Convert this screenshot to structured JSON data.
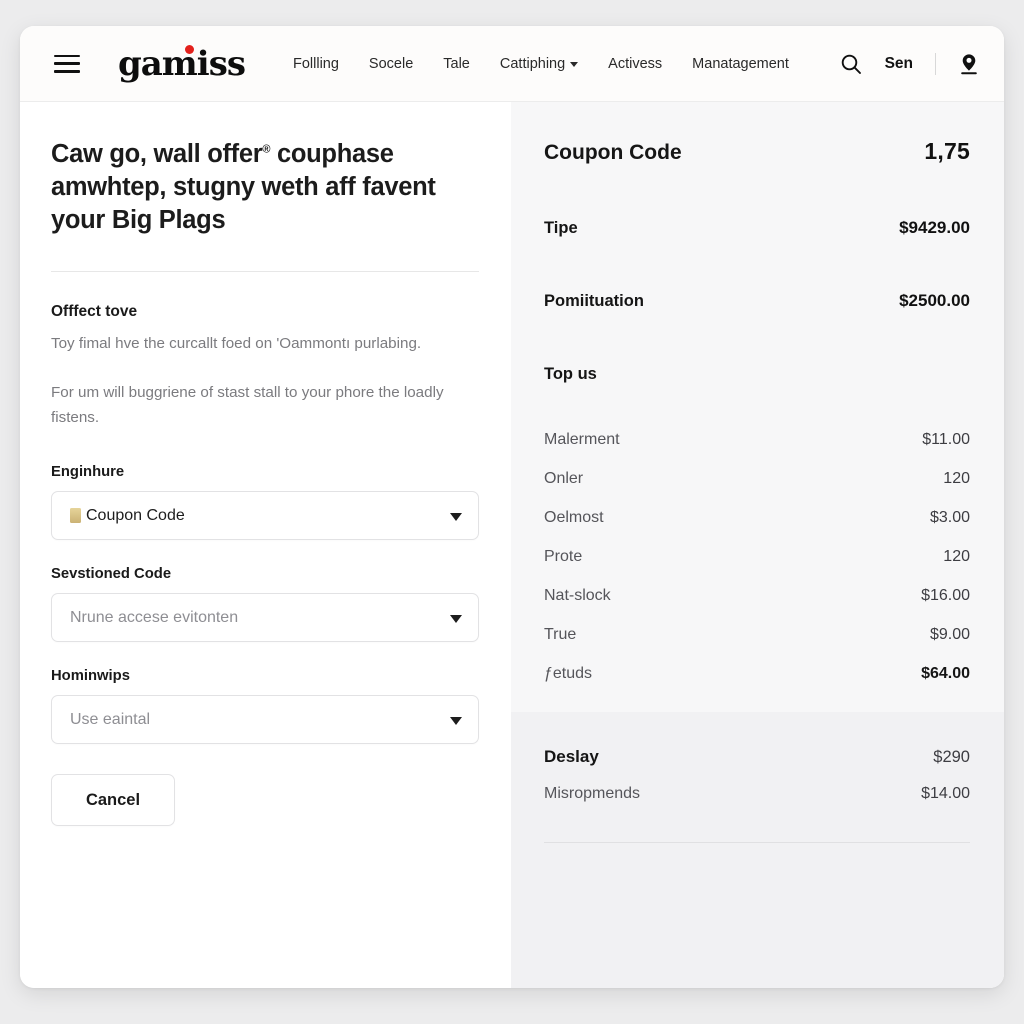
{
  "header": {
    "menu_icon": "hamburger-icon",
    "brand": "gamiss",
    "nav": [
      {
        "label": "Follling",
        "has_caret": false
      },
      {
        "label": "Socele",
        "has_caret": false
      },
      {
        "label": "Tale",
        "has_caret": false
      },
      {
        "label": "Cattiphing",
        "has_caret": true
      },
      {
        "label": "Activess",
        "has_caret": false
      },
      {
        "label": "Manatagement",
        "has_caret": false
      }
    ],
    "search_icon": "search-icon",
    "signin_label": "Sen",
    "account_icon": "account-pin-icon"
  },
  "left": {
    "title": "Caw go, wall offer",
    "title_sup": "®",
    "title_rest": " couphase amwhtep, stugny weth aff favent your Big Plags",
    "section_heading": "Offfect tove",
    "paragraph_1": "Toy fimal hve the curcallt foed on 'Oammontı purlabing.",
    "paragraph_2": "For um will buggriene of stast stall to your phore the loadly fistens.",
    "fields": [
      {
        "label": "Enginhure",
        "value": "Coupon Code",
        "is_placeholder": false,
        "has_chip": true
      },
      {
        "label": "Sevstioned Code",
        "value": "Nrune accese evitonten",
        "is_placeholder": true,
        "has_chip": false
      },
      {
        "label": "Hominwips",
        "value": "Use eaintal",
        "is_placeholder": true,
        "has_chip": false
      }
    ],
    "cancel_label": "Cancel"
  },
  "right": {
    "headline_label": "Coupon Code",
    "headline_value": "1,75",
    "summary_rows": [
      {
        "label": "Tipe",
        "value": "$9429.00"
      },
      {
        "label": "Pomiituation",
        "value": "$2500.00"
      }
    ],
    "group_title": "Top us",
    "line_items": [
      {
        "label": "Malerment",
        "value": "$11.00",
        "strong": false
      },
      {
        "label": "Onler",
        "value": "120",
        "strong": false
      },
      {
        "label": "Oelmost",
        "value": "$3.00",
        "strong": false
      },
      {
        "label": "Prote",
        "value": "120",
        "strong": false
      },
      {
        "label": "Nat-slock",
        "value": "$16.00",
        "strong": false
      },
      {
        "label": "True",
        "value": "$9.00",
        "strong": false
      },
      {
        "label": "ƒetuds",
        "value": "$64.00",
        "strong": true
      }
    ],
    "totals": [
      {
        "label": "Deslay",
        "value": "$290",
        "kind": "grand"
      },
      {
        "label": "Misropmends",
        "value": "$14.00",
        "kind": "minor"
      }
    ]
  },
  "colors": {
    "brand_dot": "#e3211c",
    "card_bg": "#ffffff",
    "page_bg": "#ececed",
    "summary_bg": "#f7f7f8",
    "summary_bottom_bg": "#f1f1f3",
    "text_primary": "#1a1a1a",
    "text_muted": "#7b7b7f",
    "coupon_chip": "#cbb274"
  }
}
